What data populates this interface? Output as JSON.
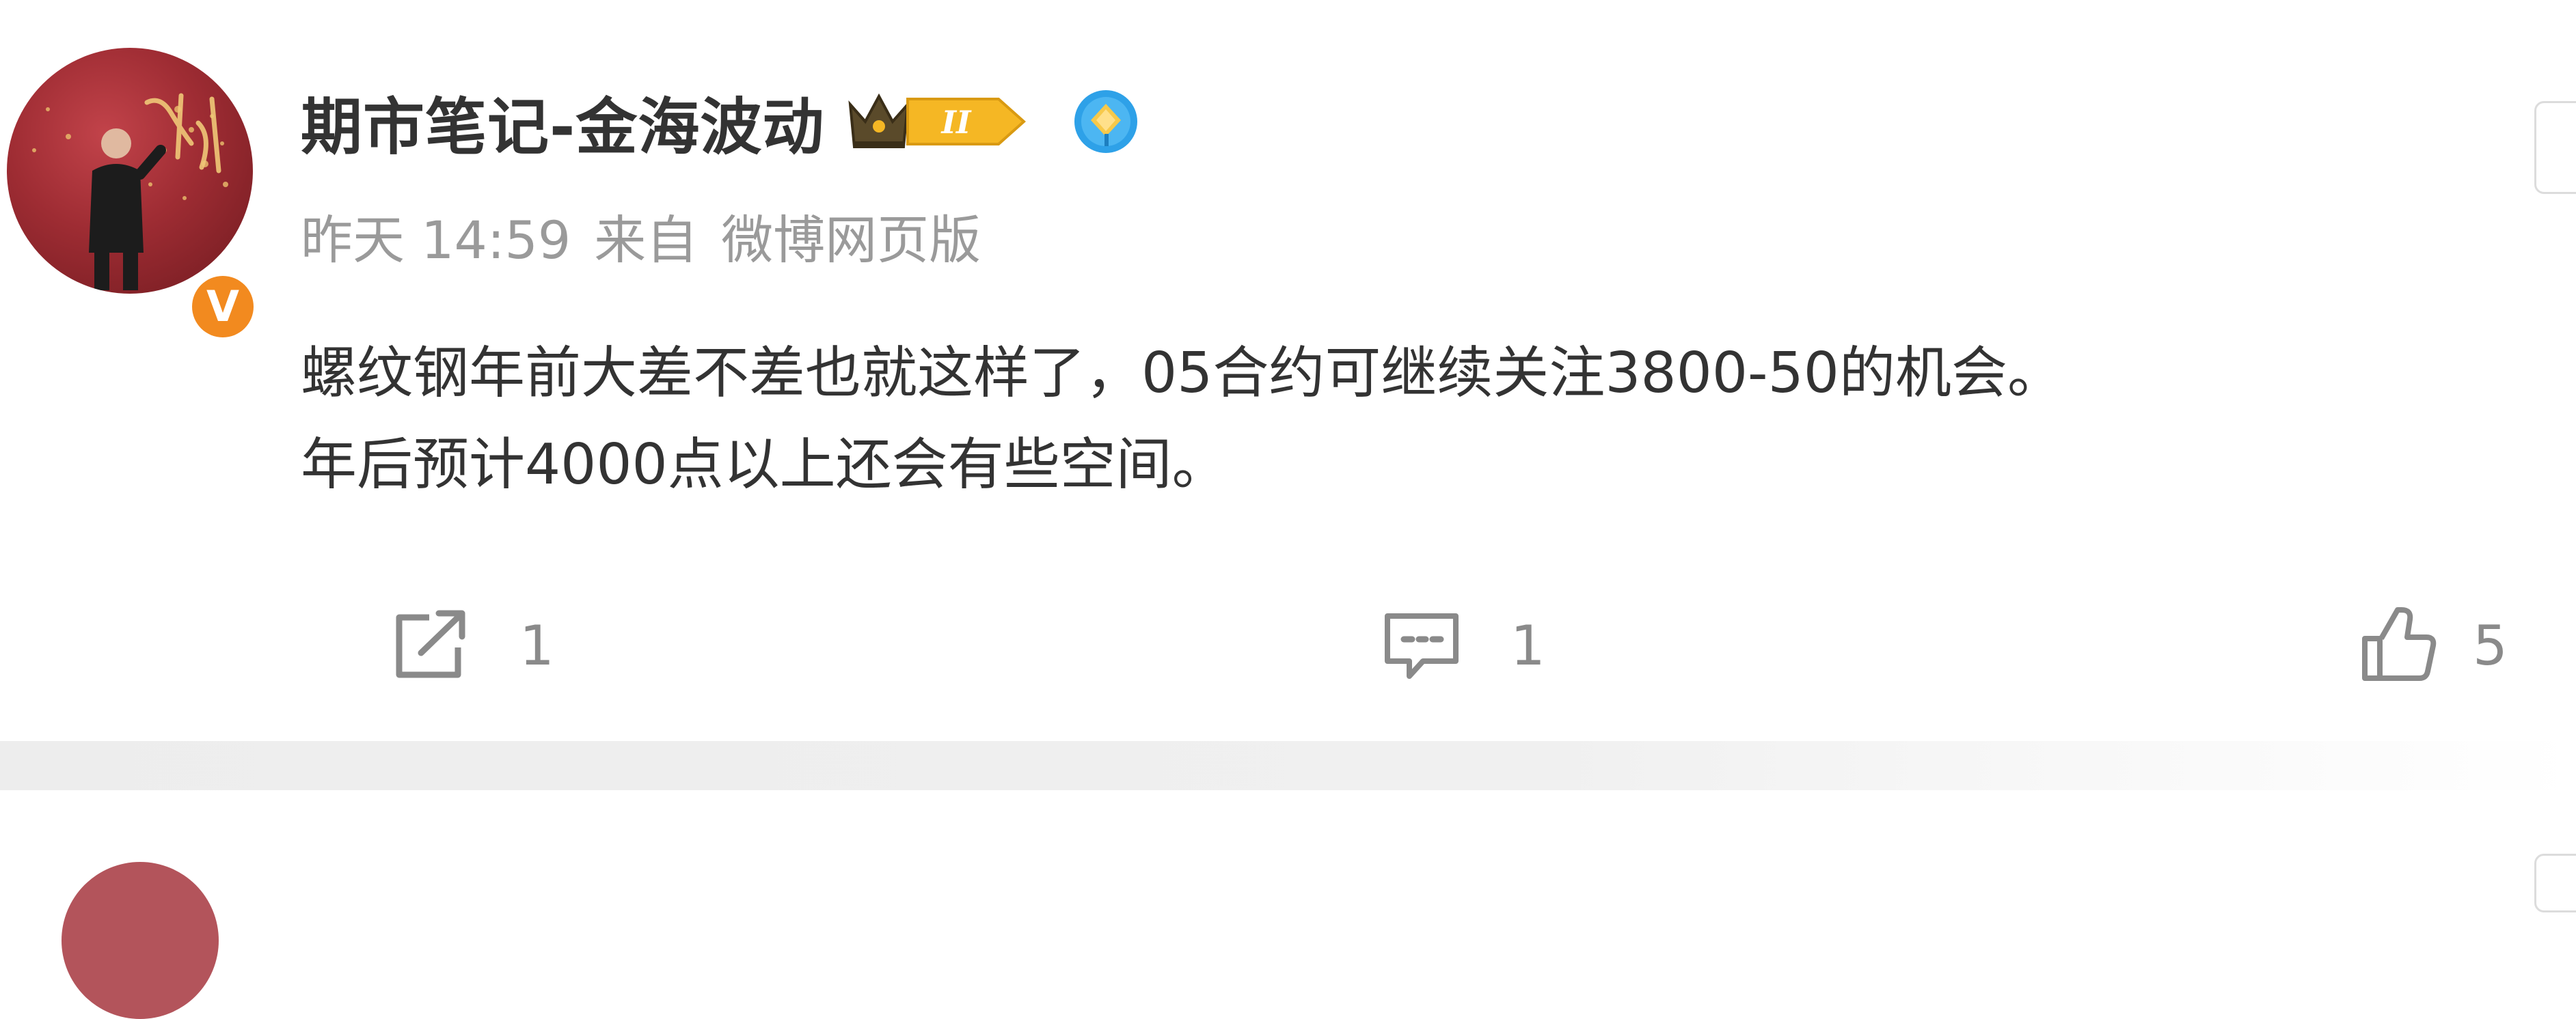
{
  "post": {
    "author": {
      "name": "期市笔记-金海波动",
      "avatar_icon": "avatar-photo",
      "verified_icon": "orange-verified-v-icon",
      "verified_symbol": "V",
      "level_badge_label": "II",
      "level_badge_icon": "crown-level-badge-icon",
      "member_icon": "blue-diamond-member-icon"
    },
    "meta": {
      "time": "昨天 14:59",
      "source_prefix": "来自",
      "source": "微博网页版"
    },
    "content": {
      "lines": [
        "螺纹钢年前大差不差也就这样了，05合约可继续关注3800-50的机会。",
        "年后预计4000点以上还会有些空间。"
      ]
    },
    "actions": {
      "share": {
        "icon": "share-icon",
        "count": "1"
      },
      "comment": {
        "icon": "comment-icon",
        "count": "1"
      },
      "like": {
        "icon": "thumbs-up-icon",
        "count": "5"
      }
    }
  },
  "colors": {
    "text_primary": "#333333",
    "text_secondary": "#9a9a9a",
    "action_gray": "#8a8a8a",
    "verified_orange": "#f28a1f",
    "crown_gold": "#f5b724",
    "member_blue": "#2ea1e8",
    "divider_gray": "#eeeeee"
  }
}
